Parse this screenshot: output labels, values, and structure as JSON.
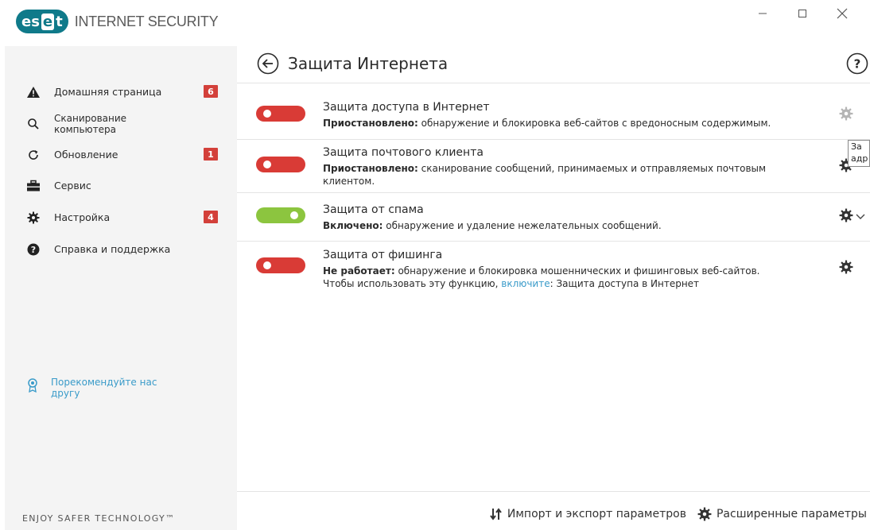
{
  "app": {
    "logo_text": "eset",
    "logo_segments": [
      "es",
      "e",
      "t"
    ],
    "product_name": "INTERNET SECURITY",
    "brand_tagline": "ENJOY SAFER TECHNOLOGY™"
  },
  "window_controls": {
    "minimize_icon": "minimize-icon",
    "maximize_icon": "maximize-icon",
    "close_icon": "close-icon"
  },
  "sidebar": {
    "items": [
      {
        "label": "Домашняя страница",
        "icon": "warning-icon",
        "badge": "6"
      },
      {
        "label": "Сканирование компьютера",
        "icon": "search-icon",
        "badge": ""
      },
      {
        "label": "Обновление",
        "icon": "refresh-icon",
        "badge": "1"
      },
      {
        "label": "Сервис",
        "icon": "toolbox-icon",
        "badge": ""
      },
      {
        "label": "Настройка",
        "icon": "gear-icon",
        "badge": "4"
      },
      {
        "label": "Справка и поддержка",
        "icon": "help-icon",
        "badge": ""
      }
    ],
    "recommend_label": "Порекомендуйте нас другу"
  },
  "main": {
    "title": "Защита Интернета",
    "features": [
      {
        "title": "Защита доступа в Интернет",
        "status_label": "Приостановлено:",
        "description": " обнаружение и блокировка веб-сайтов с вредоносным содержимым.",
        "enabled": false
      },
      {
        "title": "Защита почтового клиента",
        "status_label": "Приостановлено:",
        "description": " сканирование сообщений, принимаемых и отправляемых почтовым клиентом.",
        "enabled": false
      },
      {
        "title": "Защита от спама",
        "status_label": "Включено:",
        "description": " обнаружение и удаление нежелательных сообщений.",
        "enabled": true
      },
      {
        "title": "Защита от фишинга",
        "status_label": "Не работает:",
        "description": " обнаружение и блокировка мошеннических и фишинговых веб-сайтов.",
        "extra_prefix": "Чтобы использовать эту функцию, ",
        "extra_link": "включите",
        "extra_suffix": ": Защита доступа в Интернет",
        "enabled": false
      }
    ]
  },
  "tooltip": {
    "line1": "За",
    "line2": "адр"
  },
  "footer": {
    "import_export_label": "Импорт и экспорт параметров",
    "advanced_label": "Расширенные параметры"
  },
  "colors": {
    "accent": "#0f7a8a",
    "toggle_off": "#d93b36",
    "toggle_on": "#8cc53f",
    "badge": "#d3403a",
    "link": "#3a9bc9"
  }
}
